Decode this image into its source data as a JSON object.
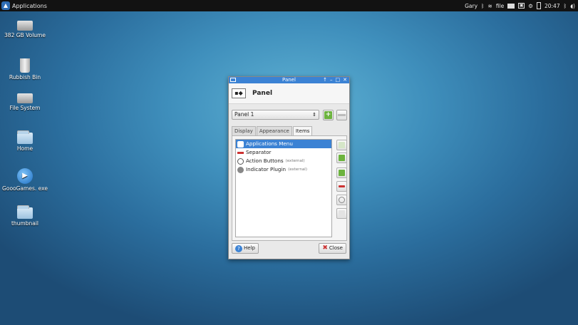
{
  "top_panel": {
    "app_menu_label": "Applications",
    "user": "Gary",
    "wifi_label": "file",
    "clock": "20:47",
    "icons": [
      "bluetooth-icon",
      "wifi-icon",
      "mail-icon",
      "keyboard-icon",
      "settings-icon",
      "battery-icon",
      "bluetooth-icon",
      "volume-icon"
    ]
  },
  "desktop": {
    "icons": [
      {
        "name": "382 GB Volume",
        "type": "drive"
      },
      {
        "name": "Rubbish Bin",
        "type": "bin"
      },
      {
        "name": "File System",
        "type": "drive"
      },
      {
        "name": "Home",
        "type": "home-folder"
      },
      {
        "name": "GoooGames. exe",
        "type": "media"
      },
      {
        "name": "thumbnail",
        "type": "folder"
      }
    ]
  },
  "dialog": {
    "window_title": "Panel",
    "header_title": "Panel",
    "panel_select": "Panel 1",
    "tabs": [
      "Display",
      "Appearance",
      "Items"
    ],
    "active_tab": "Items",
    "items": [
      {
        "label": "Applications Menu",
        "ext": "",
        "selected": true,
        "icon": "applications-menu-icon"
      },
      {
        "label": "Separator",
        "ext": "",
        "selected": false,
        "icon": "separator-icon"
      },
      {
        "label": "Action Buttons",
        "ext": "(external)",
        "selected": false,
        "icon": "power-icon"
      },
      {
        "label": "Indicator Plugin",
        "ext": "(external)",
        "selected": false,
        "icon": "indicator-icon"
      }
    ],
    "help_label": "Help",
    "close_label": "Close"
  }
}
